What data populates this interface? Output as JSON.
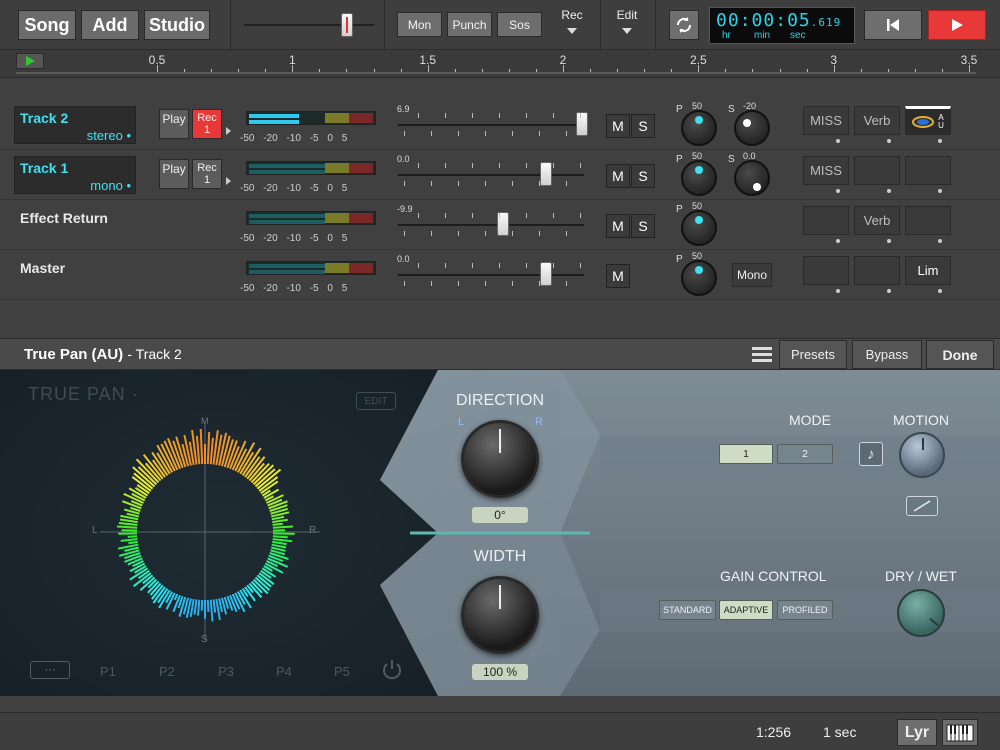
{
  "topbar": {
    "song": "Song",
    "add": "Add",
    "studio": "Studio",
    "mon": "Mon",
    "punch": "Punch",
    "sos": "Sos",
    "rec": "Rec",
    "edit": "Edit",
    "time_hr": "00",
    "time_min": "00",
    "time_sec": "05",
    "time_frac": "619",
    "unit_hr": "hr",
    "unit_min": "min",
    "unit_sec": "sec",
    "master_position": 0.82
  },
  "ruler": {
    "labels": [
      "0.5",
      "1",
      "1.5",
      "2",
      "2.5",
      "3",
      "3.5"
    ],
    "values": [
      0.5,
      1,
      1.5,
      2,
      2.5,
      3,
      3.5
    ]
  },
  "tracks": [
    {
      "name": "Track 2",
      "sub": "stereo",
      "play": "Play",
      "rec": "Rec",
      "rec_num": "1",
      "fader_value": "6.9",
      "fader": 0.99,
      "pan_label": "P",
      "pan_value": "50",
      "send_label": "S",
      "send_value": "-20",
      "fx": [
        "MISS",
        "Verb",
        ""
      ],
      "au": "AU",
      "meter": 0.6
    },
    {
      "name": "Track 1",
      "sub": "mono",
      "play": "Play",
      "rec": "Rec",
      "rec_num": "1",
      "fader_value": "0.0",
      "fader": 0.79,
      "pan_label": "P",
      "pan_value": "50",
      "send_label": "S",
      "send_value": "0.0",
      "fx": [
        "MISS",
        "",
        ""
      ],
      "meter": 0
    },
    {
      "name": "Effect Return",
      "fader_value": "-9.9",
      "fader": 0.55,
      "pan_label": "P",
      "pan_value": "50",
      "fx": [
        "",
        "Verb",
        ""
      ],
      "meter": 0
    },
    {
      "name": "Master",
      "fader_value": "0.0",
      "fader": 0.79,
      "pan_label": "P",
      "pan_value": "50",
      "mono": "Mono",
      "fx": [
        "",
        "",
        "Lim"
      ],
      "meter": 0
    }
  ],
  "meter_scale": "-50 -20 -10 -5 0 5",
  "mute": "M",
  "solo": "S",
  "plugin": {
    "title": "True Pan (AU)",
    "subtitle": "- Track 2",
    "presets": "Presets",
    "bypass": "Bypass",
    "done": "Done",
    "brand": "TRUE PAN",
    "edit": "EDIT",
    "axis_l": "L",
    "axis_r": "R",
    "axis_s": "S",
    "axis_m": "M",
    "more": "···",
    "presets_slots": [
      "P1",
      "P2",
      "P3",
      "P4",
      "P5"
    ],
    "direction_label": "DIRECTION",
    "direction_l": "L",
    "direction_r": "R",
    "direction_value": "0°",
    "width_label": "WIDTH",
    "width_value": "100 %",
    "mode_label": "MODE",
    "mode_options": [
      "1",
      "2"
    ],
    "mode_selected": "1",
    "motion_label": "MOTION",
    "gain_label": "GAIN CONTROL",
    "gain_options": [
      "STANDARD",
      "ADAPTIVE",
      "PROFILED"
    ],
    "gain_selected": "ADAPTIVE",
    "drywet_label": "DRY / WET"
  },
  "bottombar": {
    "ratio": "1:256",
    "duration": "1 sec",
    "lyr": "Lyr"
  },
  "colors": {
    "accent_cyan": "#3fe0f0",
    "rec_red": "#e83838",
    "play_green": "#32c832",
    "panel_steel": "#7c8a94"
  }
}
